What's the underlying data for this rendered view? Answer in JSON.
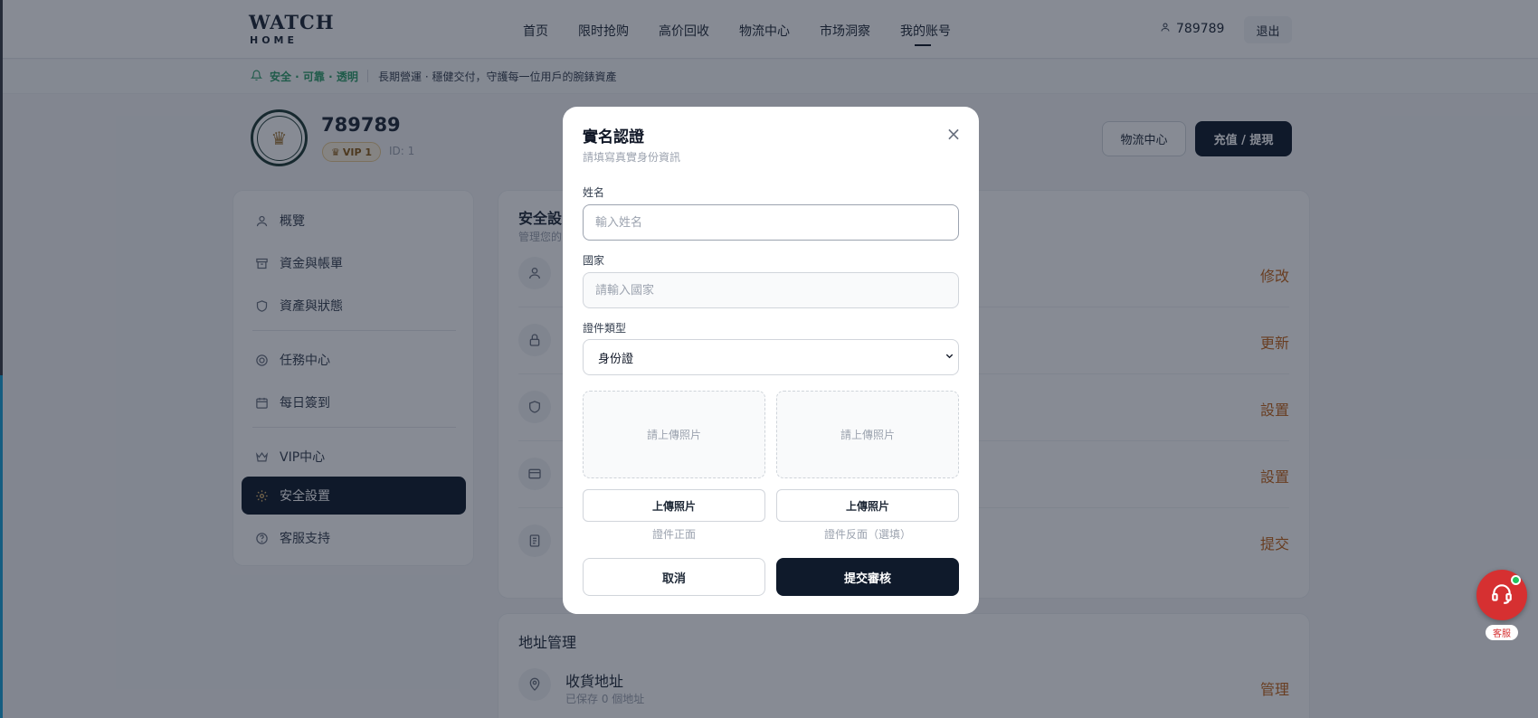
{
  "header": {
    "logo_main": "WATCH",
    "logo_sub": "HOME",
    "nav": [
      "首页",
      "限时抢购",
      "高价回收",
      "物流中心",
      "市场洞察",
      "我的账号"
    ],
    "active_nav": "我的账号",
    "username": "789789",
    "logout_label": "退出"
  },
  "notice": {
    "tag": "安全 · 可靠 · 透明",
    "message": "長期營運 · 穩健交付，守護每一位用戶的腕錶資產"
  },
  "profile": {
    "name": "789789",
    "vip": "VIP 1",
    "id_label": "ID: 1",
    "logistics_button": "物流中心",
    "recharge_button": "充值 / 提現"
  },
  "sidebar": {
    "items": [
      {
        "label": "概覽",
        "icon": "user-icon"
      },
      {
        "label": "資金與帳單",
        "icon": "archive-icon"
      },
      {
        "label": "資產與狀態",
        "icon": "shield-icon"
      },
      {
        "label": "任務中心",
        "icon": "target-icon"
      },
      {
        "label": "每日簽到",
        "icon": "calendar-icon"
      },
      {
        "label": "VIP中心",
        "icon": "crown-icon"
      },
      {
        "label": "安全設置",
        "icon": "gear-icon",
        "active": true
      },
      {
        "label": "客服支持",
        "icon": "help-icon"
      }
    ]
  },
  "security": {
    "title": "安全設",
    "subtitle": "管理您的",
    "rows": [
      {
        "icon": "user-icon",
        "action": "修改"
      },
      {
        "icon": "lock-icon",
        "action": "更新"
      },
      {
        "icon": "shield-icon",
        "action": "設置"
      },
      {
        "icon": "card-icon",
        "action": "設置"
      },
      {
        "icon": "document-icon",
        "action": "提交"
      }
    ]
  },
  "address": {
    "title": "地址管理",
    "name": "收貨地址",
    "sub": "已保存 0 個地址",
    "action": "管理"
  },
  "modal": {
    "title": "實名認證",
    "subtitle": "請填寫真實身份資訊",
    "name_label": "姓名",
    "name_placeholder": "輸入姓名",
    "country_label": "國家",
    "country_placeholder": "請輸入國家",
    "id_type_label": "證件類型",
    "id_type_value": "身份證",
    "upload_placeholder": "請上傳照片",
    "upload_button": "上傳照片",
    "front_caption": "證件正面",
    "back_caption": "證件反面（選填）",
    "cancel": "取消",
    "submit": "提交審核"
  },
  "support": {
    "label": "客服"
  },
  "colors": {
    "primary_dark": "#0f1a2b",
    "accent_orange": "#c2651a",
    "accent_green": "#2f9e6a",
    "support_red": "#d63031"
  }
}
